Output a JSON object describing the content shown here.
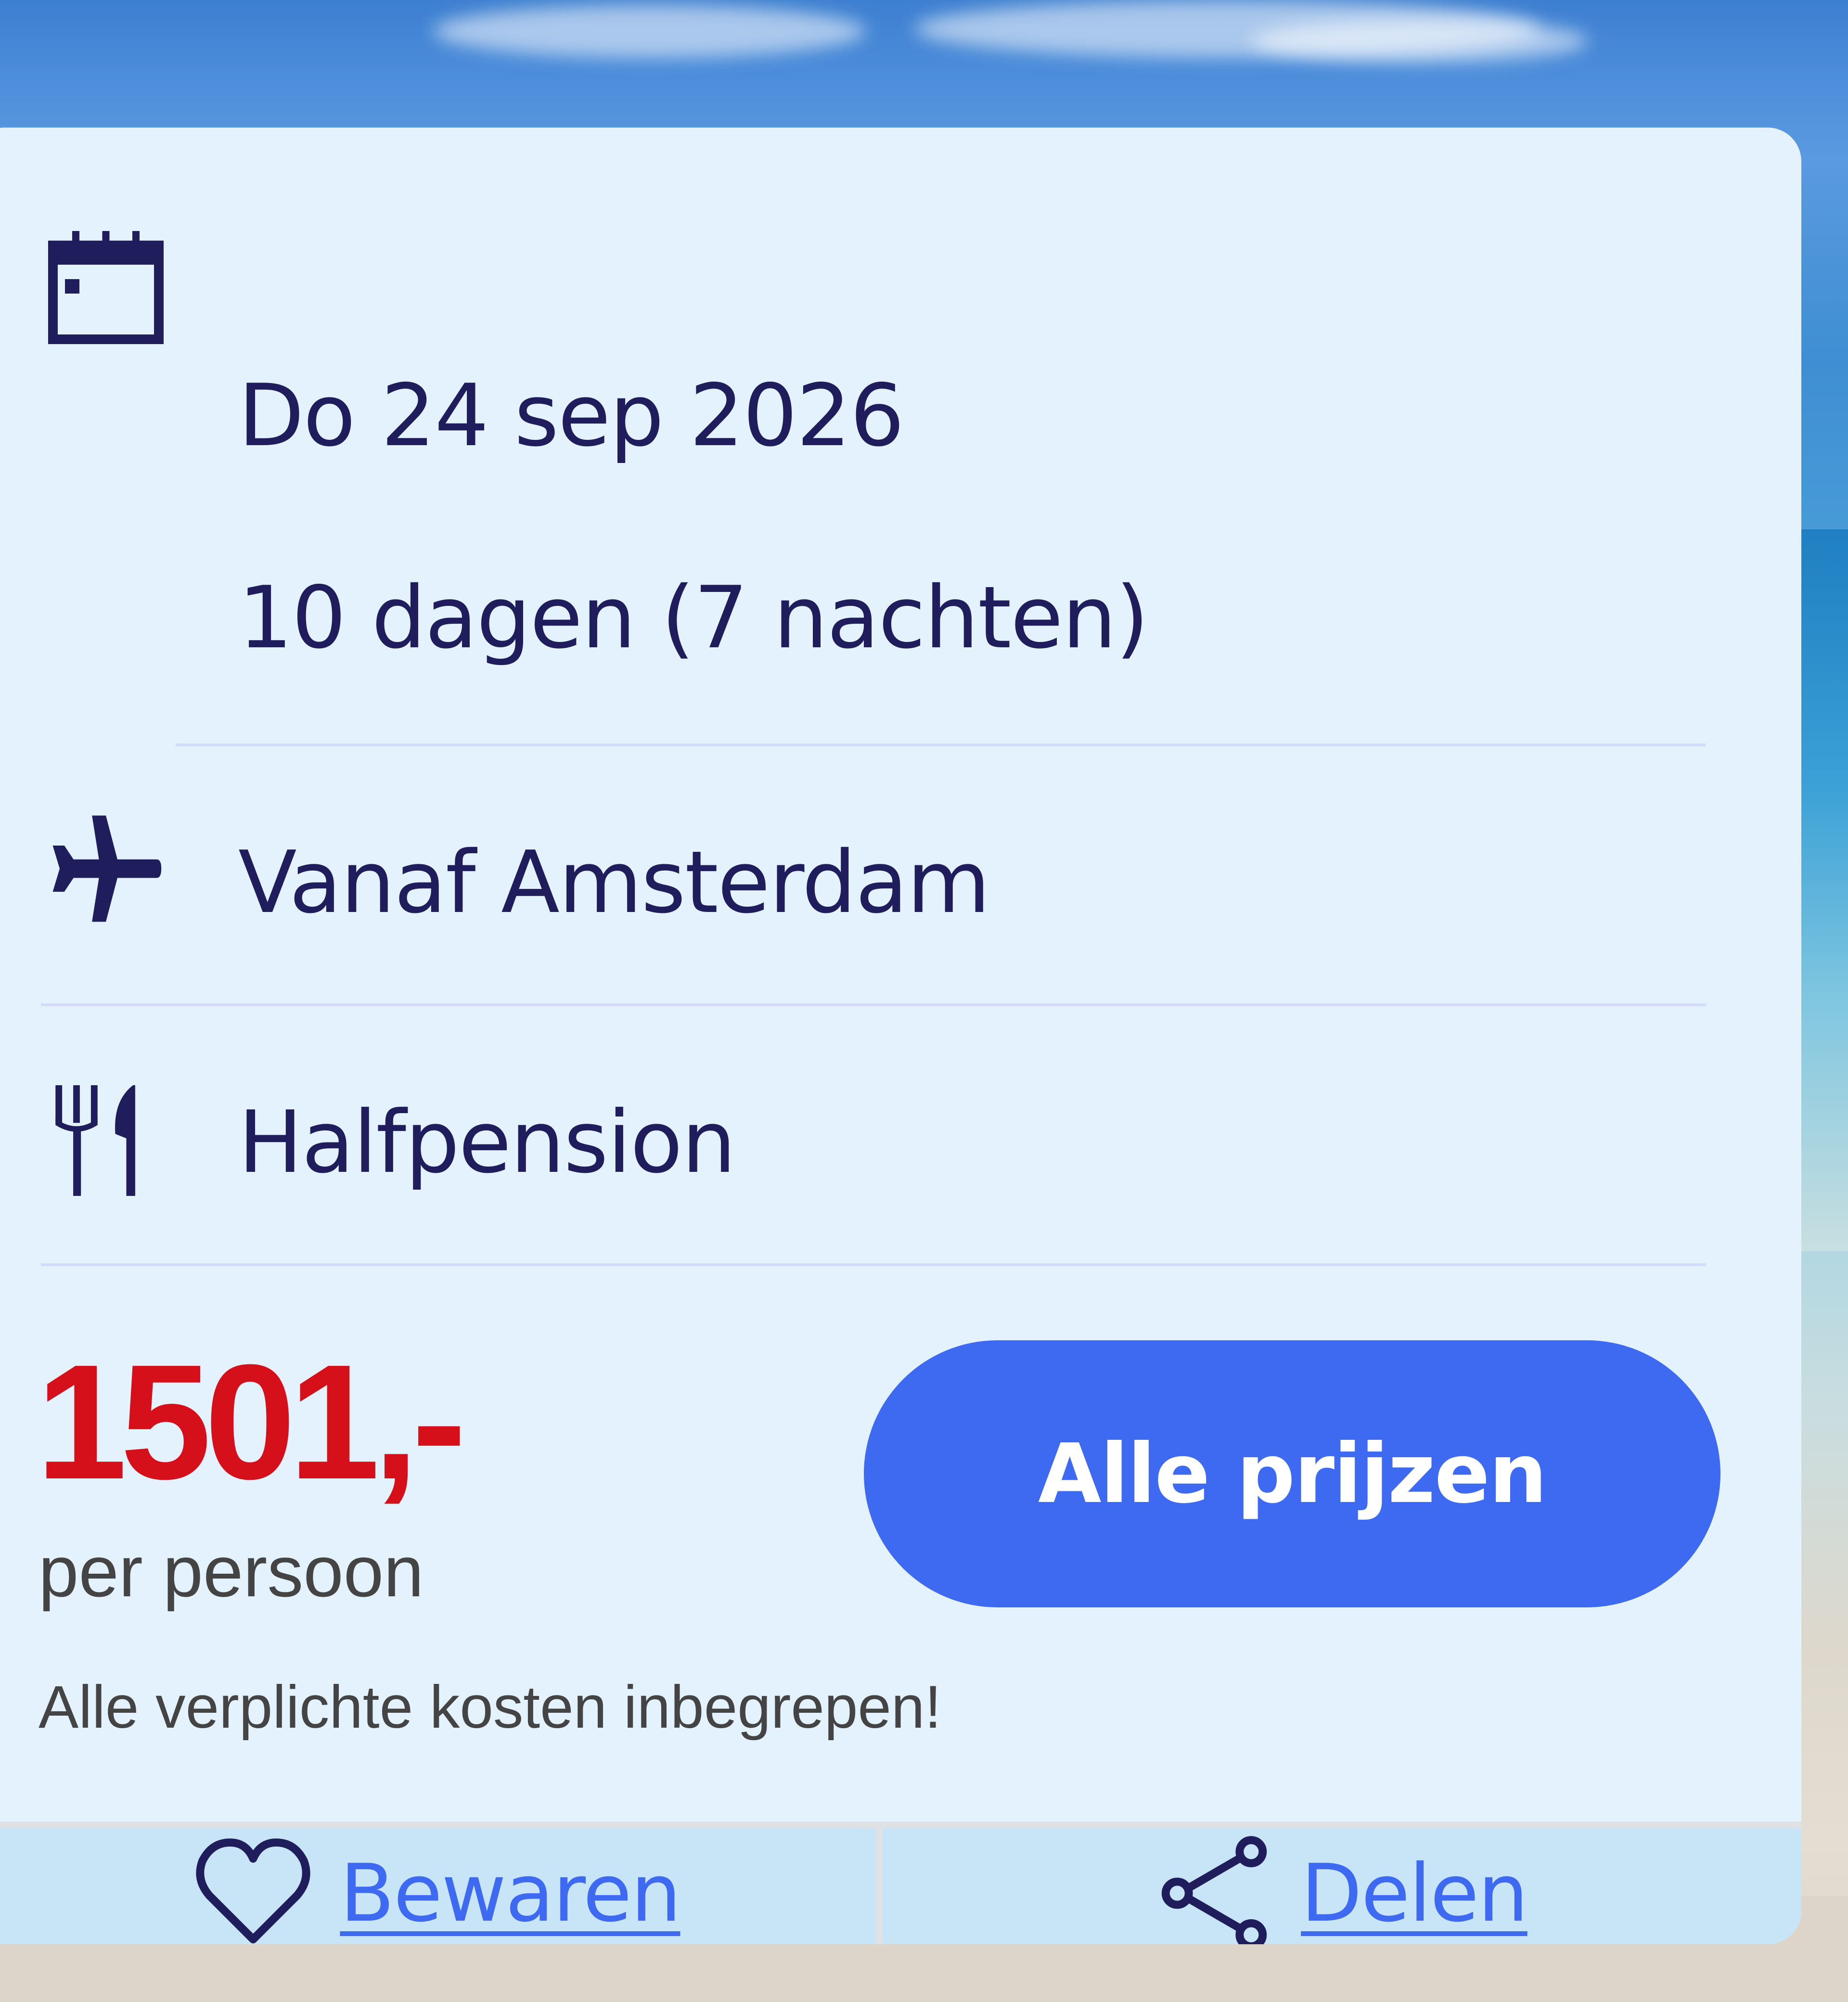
{
  "trip": {
    "date": "Do 24 sep 2026",
    "duration": "10 dagen (7 nachten)",
    "departure": "Vanaf Amsterdam",
    "board": "Halfpension"
  },
  "price": {
    "amount": "1501,-",
    "unit": "per persoon",
    "note": "Alle verplichte kosten inbegrepen!"
  },
  "buttons": {
    "all_prices": "Alle prijzen"
  },
  "actions": {
    "save": "Bewaren",
    "share": "Delen"
  },
  "icons": {
    "date": "calendar-icon",
    "departure": "airplane-icon",
    "board": "cutlery-icon",
    "save": "heart-icon",
    "share": "share-icon"
  },
  "colors": {
    "card_bg": "#e3f2fd",
    "text": "#1f1d5c",
    "price": "#d6101a",
    "accent": "#3d6af0",
    "action_bar": "#c8e5f8"
  }
}
